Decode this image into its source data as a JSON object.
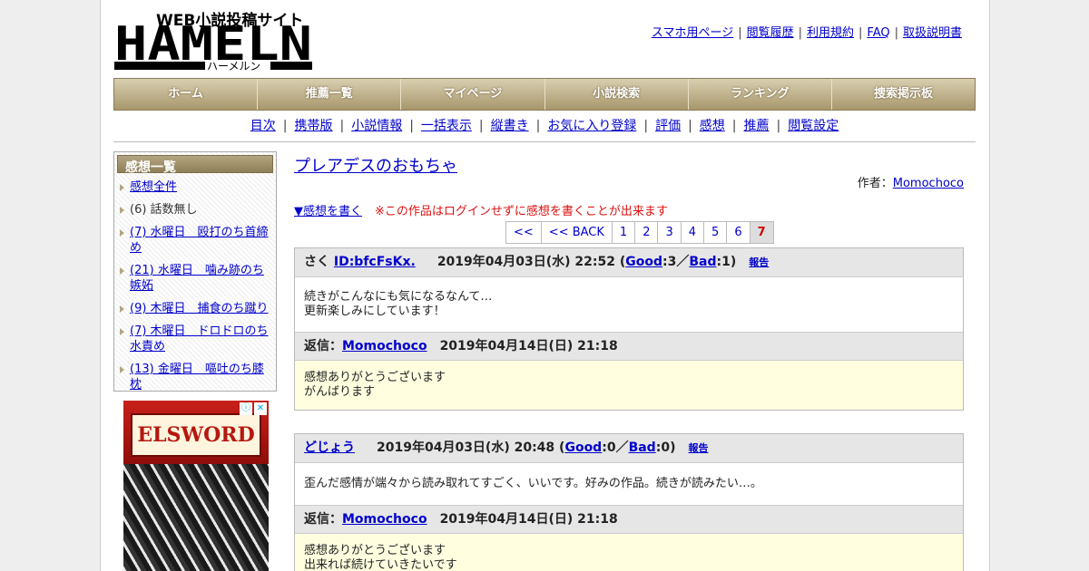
{
  "header": {
    "logo_main": "HAMELN",
    "logo_sub": "WEB小説投稿サイト",
    "logo_kana": "ハーメルン",
    "toplinks": [
      "スマホ用ページ",
      "閲覧履歴",
      "利用規約",
      "FAQ",
      "取扱説明書"
    ]
  },
  "nav": [
    "ホーム",
    "推薦一覧",
    "マイページ",
    "小説検索",
    "ランキング",
    "捜索掲示板"
  ],
  "subnav": [
    "目次",
    "携帯版",
    "小説情報",
    "一括表示",
    "縦書き",
    "お気に入り登録",
    "評価",
    "感想",
    "推薦",
    "閲覧設定"
  ],
  "sidebar": {
    "title": "感想一覧",
    "items": [
      {
        "label": "感想全件",
        "link": true
      },
      {
        "label": "(6) 話数無し",
        "link": false
      },
      {
        "label": "(7) 水曜日　殴打のち首締め",
        "link": true
      },
      {
        "label": "(21) 水曜日　噛み跡のち嫉妬",
        "link": true
      },
      {
        "label": "(9) 木曜日　捕食のち蹴り",
        "link": true
      },
      {
        "label": "(7) 木曜日　ドロドロのち水責め",
        "link": true
      },
      {
        "label": "(13) 金曜日　嘔吐のち膝枕",
        "link": true
      }
    ]
  },
  "ad": {
    "brand": "ELSWORD"
  },
  "work": {
    "title": "プレアデスのおもちゃ",
    "author_label": "作者：",
    "author": "Momochoco"
  },
  "write": {
    "link": "▼感想を書く",
    "warning": "※この作品はログインせずに感想を書くことが出来ます"
  },
  "pager": [
    "<<",
    "<< BACK",
    "1",
    "2",
    "3",
    "4",
    "5",
    "6",
    "7"
  ],
  "pager_current": "7",
  "comments": [
    {
      "prefix": "さく ",
      "user": "ID:bfcFsKx.",
      "date": "2019年04月03日(水) 22:52",
      "good_label": "Good",
      "good": "3",
      "bad_label": "Bad",
      "bad": "1",
      "report": "報告",
      "body": [
        "続きがこんなにも気になるなんて…",
        "更新楽しみにしています！"
      ],
      "reply_label": "返信：",
      "reply_user": "Momochoco",
      "reply_date": "2019年04月14日(日) 21:18",
      "reply_body": [
        "感想ありがとうございます",
        "がんばります"
      ]
    },
    {
      "prefix": "",
      "user": "どじょう",
      "date": "2019年04月03日(水) 20:48",
      "good_label": "Good",
      "good": "0",
      "bad_label": "Bad",
      "bad": "0",
      "report": "報告",
      "body": [
        "歪んだ感情が端々から読み取れてすごく、いいです。好みの作品。続きが読みたい…。"
      ],
      "reply_label": "返信：",
      "reply_user": "Momochoco",
      "reply_date": "2019年04月14日(日) 21:18",
      "reply_body": [
        "感想ありがとうございます",
        "出来れば続けていきたいです"
      ]
    }
  ]
}
